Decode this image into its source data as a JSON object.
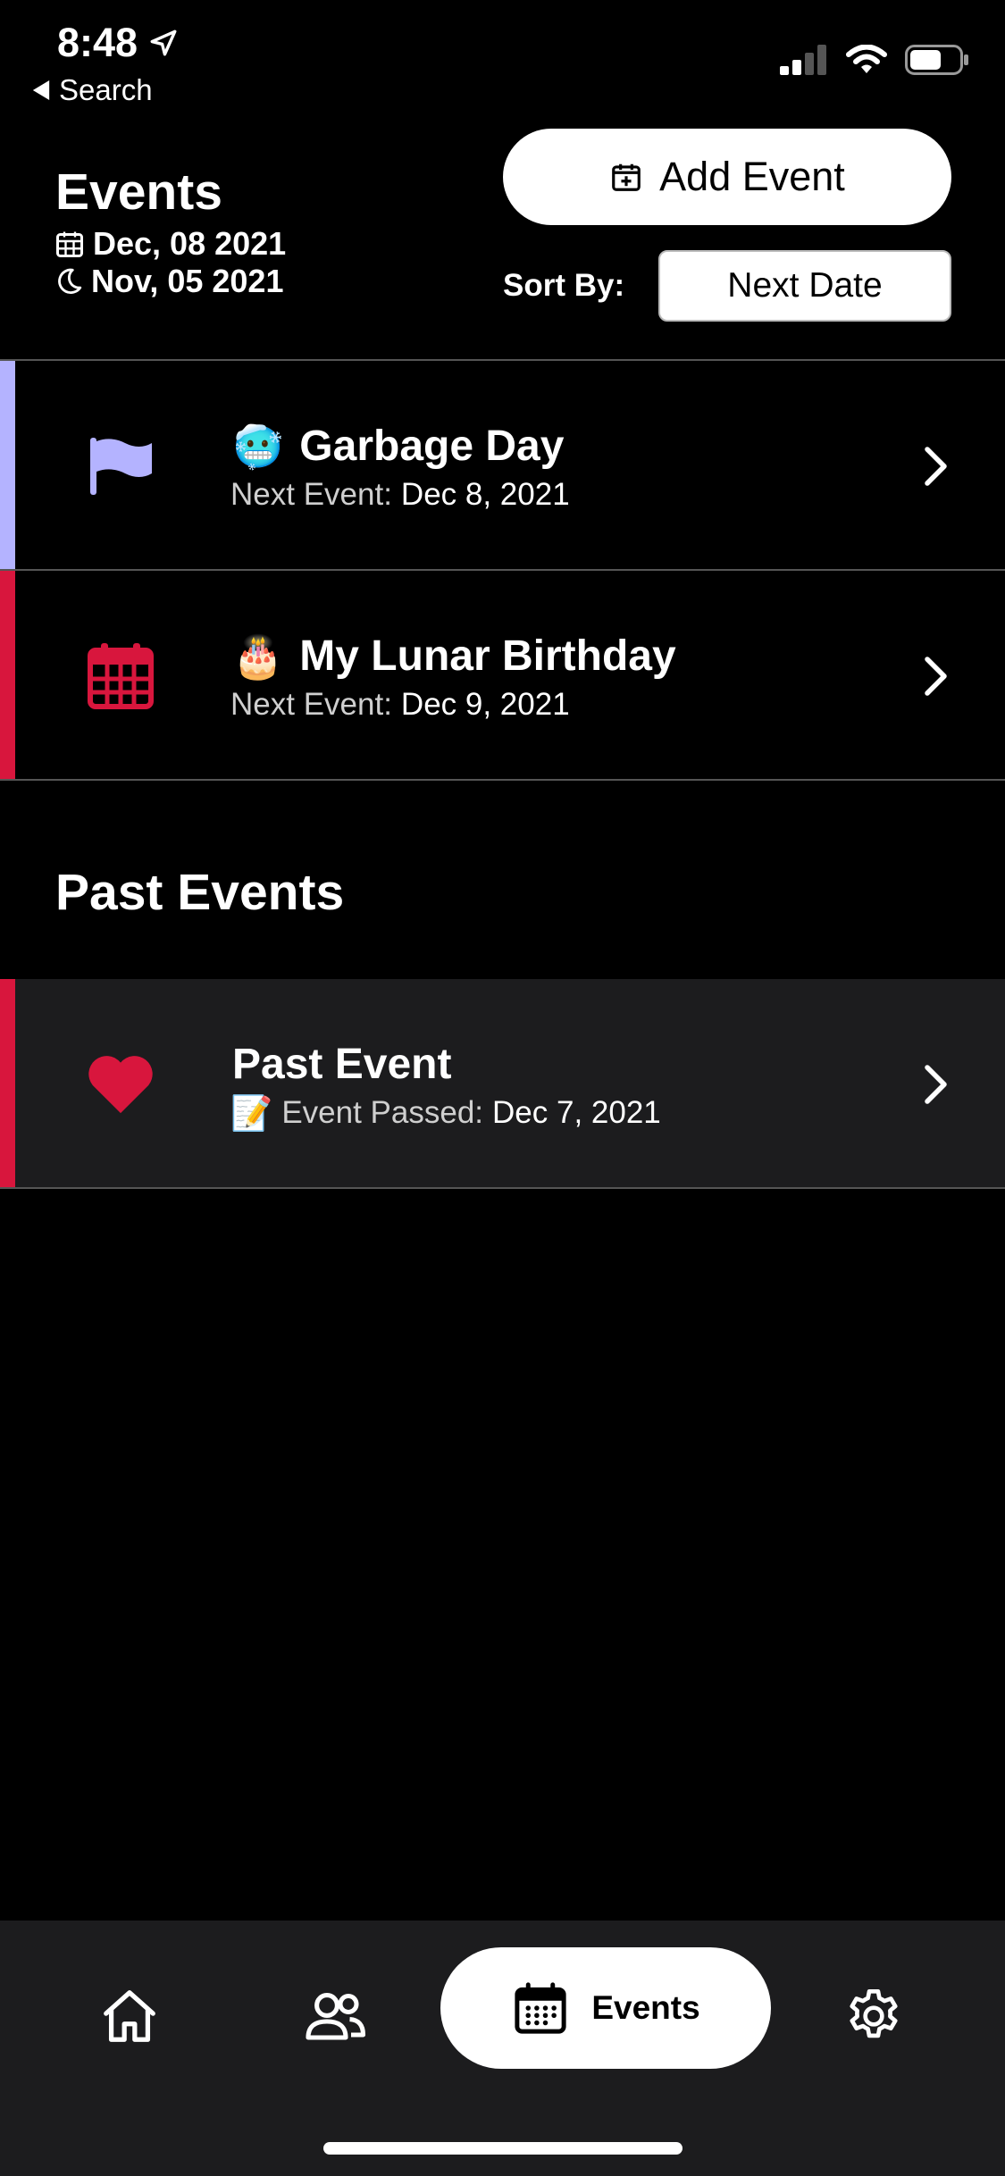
{
  "status_bar": {
    "time": "8:48",
    "back_label": "Search"
  },
  "header": {
    "title": "Events",
    "date_gregorian": "Dec, 08 2021",
    "date_lunar": "Nov, 05 2021",
    "add_button_label": "Add Event",
    "sort_label": "Sort By:",
    "sort_value": "Next Date"
  },
  "events": [
    {
      "emoji": "🥶",
      "name": "Garbage Day",
      "sub_key": "Next Event:",
      "sub_value": "Dec 8, 2021",
      "icon": "flag-icon",
      "accent": "#b4b3ff"
    },
    {
      "emoji": "🎂",
      "name": "My Lunar Birthday",
      "sub_key": "Next Event:",
      "sub_value": "Dec 9, 2021",
      "icon": "calendar-icon",
      "accent": "#d8163d"
    }
  ],
  "past_section_title": "Past Events",
  "past_events": [
    {
      "name": "Past Event",
      "sub_emoji": "📝",
      "sub_key": "Event Passed:",
      "sub_value": "Dec 7, 2021",
      "icon": "heart-icon",
      "accent": "#d8163d"
    }
  ],
  "tabbar": {
    "active_label": "Events",
    "tabs": [
      "home-icon",
      "people-icon",
      "calendar-icon",
      "gear-icon"
    ]
  },
  "colors": {
    "accent_purple": "#b4b3ff",
    "accent_red": "#d8163d",
    "row_past_bg": "#1c1c1e"
  }
}
